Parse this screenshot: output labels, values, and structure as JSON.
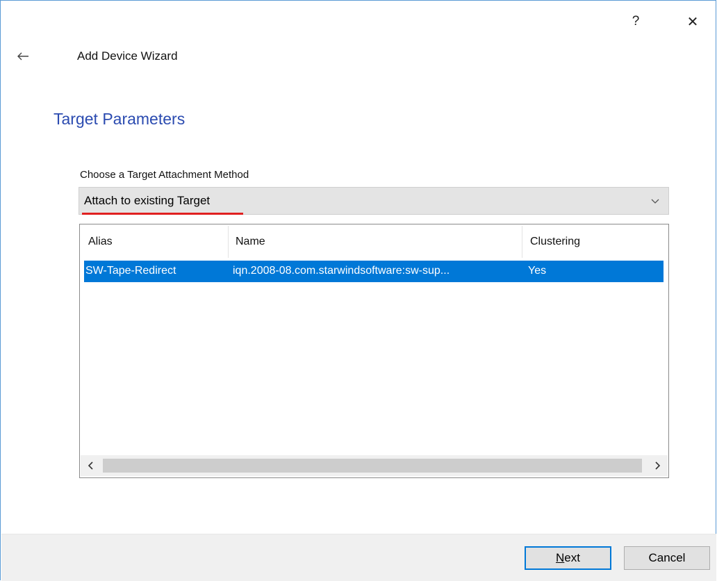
{
  "window": {
    "help_label": "?",
    "close_label": "✕",
    "wizard_title": "Add Device Wizard"
  },
  "page": {
    "section_title": "Target Parameters",
    "method_label": "Choose a Target Attachment Method",
    "method_value": "Attach to existing Target"
  },
  "targets": {
    "columns": [
      "Alias",
      "Name",
      "Clustering"
    ],
    "rows": [
      {
        "alias": "SW-Tape-Redirect",
        "name": "iqn.2008-08.com.starwindsoftware:sw-sup...",
        "clustering": "Yes",
        "selected": true
      }
    ]
  },
  "buttons": {
    "next_mnemonic": "N",
    "next_rest": "ext",
    "cancel": "Cancel"
  },
  "colors": {
    "accent": "#0078d7",
    "title": "#2b4bb0",
    "highlight_underline": "#e02020"
  },
  "icons": {
    "back": "arrow-left-icon",
    "dropdown": "chevron-down-icon",
    "scroll_left": "chevron-left-icon",
    "scroll_right": "chevron-right-icon"
  }
}
